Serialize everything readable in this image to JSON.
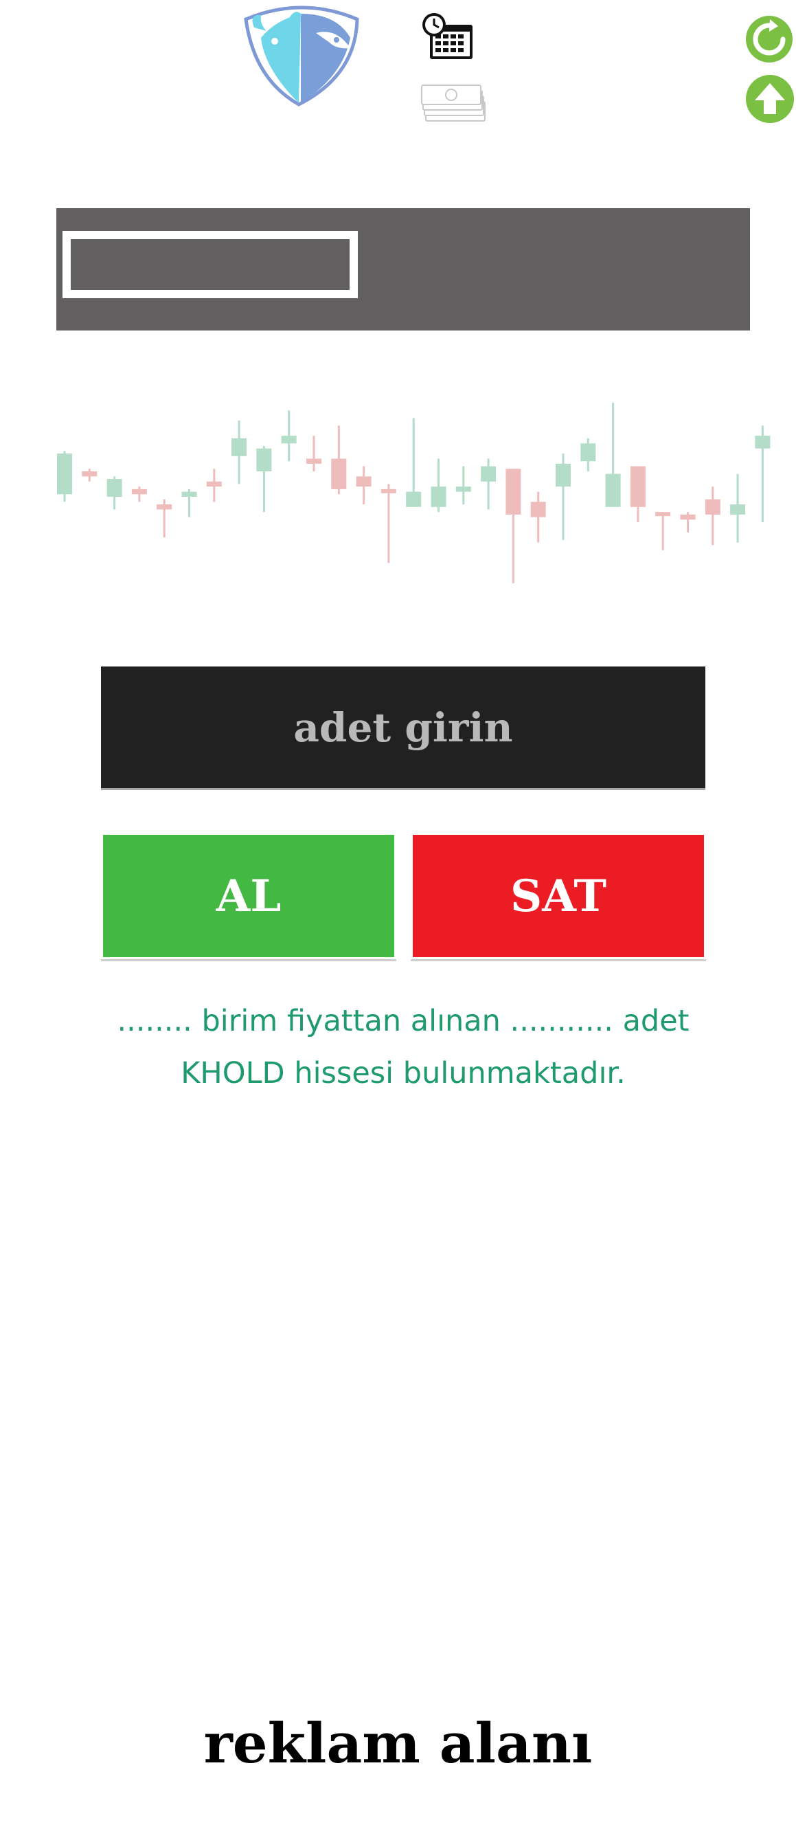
{
  "header": {
    "logo_icon": "bull-bear-shield-logo",
    "calendar_icon": "calendar-clock-icon",
    "money_icon": "money-stack-icon",
    "refresh_icon": "refresh-icon",
    "upload_icon": "arrow-up-icon",
    "accent_green": "#7cc043"
  },
  "search": {
    "value": "",
    "panel_color": "#625f60"
  },
  "chart": {
    "type": "candlestick",
    "bull_color": "#b3ddc8",
    "bear_color": "#efbcbc"
  },
  "chart_data": {
    "type": "candlestick",
    "candles": [
      {
        "o": 61,
        "c": 77,
        "h": 78,
        "l": 58
      },
      {
        "o": 70,
        "c": 68,
        "h": 71,
        "l": 66
      },
      {
        "o": 60,
        "c": 67,
        "h": 68,
        "l": 55
      },
      {
        "o": 63,
        "c": 61,
        "h": 64,
        "l": 58
      },
      {
        "o": 57,
        "c": 55,
        "h": 59,
        "l": 44
      },
      {
        "o": 60,
        "c": 62,
        "h": 63,
        "l": 52
      },
      {
        "o": 66,
        "c": 64,
        "h": 71,
        "l": 58
      },
      {
        "o": 76,
        "c": 83,
        "h": 90,
        "l": 65
      },
      {
        "o": 70,
        "c": 79,
        "h": 80,
        "l": 54
      },
      {
        "o": 81,
        "c": 84,
        "h": 94,
        "l": 74
      },
      {
        "o": 75,
        "c": 73,
        "h": 84,
        "l": 70
      },
      {
        "o": 75,
        "c": 63,
        "h": 88,
        "l": 61
      },
      {
        "o": 68,
        "c": 64,
        "h": 72,
        "l": 57
      },
      {
        "o": 63,
        "c": 62,
        "h": 65,
        "l": 34
      },
      {
        "o": 56,
        "c": 62,
        "h": 91,
        "l": 56
      },
      {
        "o": 56,
        "c": 64,
        "h": 75,
        "l": 54
      },
      {
        "o": 62,
        "c": 64,
        "h": 72,
        "l": 57
      },
      {
        "o": 66,
        "c": 72,
        "h": 75,
        "l": 55
      },
      {
        "o": 71,
        "c": 53,
        "h": 71,
        "l": 26
      },
      {
        "o": 58,
        "c": 52,
        "h": 62,
        "l": 42
      },
      {
        "o": 64,
        "c": 73,
        "h": 77,
        "l": 43
      },
      {
        "o": 74,
        "c": 81,
        "h": 83,
        "l": 70
      },
      {
        "o": 56,
        "c": 69,
        "h": 97,
        "l": 56
      },
      {
        "o": 72,
        "c": 56,
        "h": 72,
        "l": 50
      },
      {
        "o": 54,
        "c": 53,
        "h": 54,
        "l": 39
      },
      {
        "o": 53,
        "c": 51,
        "h": 54,
        "l": 46
      },
      {
        "o": 59,
        "c": 53,
        "h": 64,
        "l": 41
      },
      {
        "o": 53,
        "c": 57,
        "h": 69,
        "l": 42
      },
      {
        "o": 79,
        "c": 84,
        "h": 88,
        "l": 50
      }
    ]
  },
  "quantity": {
    "placeholder": "adet girin"
  },
  "actions": {
    "buy_label": "AL",
    "sell_label": "SAT",
    "buy_color": "#43b843",
    "sell_color": "#ec1c24"
  },
  "info": {
    "holding_text": "........ birim fiyattan alınan ........... adet KHOLD hissesi bulunmaktadır."
  },
  "ad": {
    "label": "reklam alanı"
  }
}
